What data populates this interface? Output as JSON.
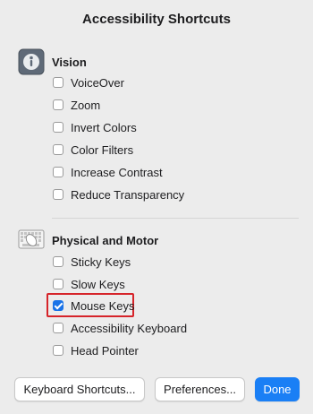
{
  "dialog": {
    "title": "Accessibility Shortcuts"
  },
  "sections": [
    {
      "title": "Vision",
      "icon": "vision-icon",
      "items": [
        {
          "label": "VoiceOver",
          "checked": false
        },
        {
          "label": "Zoom",
          "checked": false
        },
        {
          "label": "Invert Colors",
          "checked": false
        },
        {
          "label": "Color Filters",
          "checked": false
        },
        {
          "label": "Increase Contrast",
          "checked": false
        },
        {
          "label": "Reduce Transparency",
          "checked": false
        }
      ]
    },
    {
      "title": "Physical and Motor",
      "icon": "keyboard-mouse-icon",
      "items": [
        {
          "label": "Sticky Keys",
          "checked": false
        },
        {
          "label": "Slow Keys",
          "checked": false
        },
        {
          "label": "Mouse Keys",
          "checked": true
        },
        {
          "label": "Accessibility Keyboard",
          "checked": false
        },
        {
          "label": "Head Pointer",
          "checked": false
        }
      ]
    }
  ],
  "buttons": {
    "keyboard_shortcuts": "Keyboard Shortcuts...",
    "preferences": "Preferences...",
    "done": "Done"
  },
  "colors": {
    "accent": "#1a7ff5",
    "highlight": "#d6242a"
  }
}
